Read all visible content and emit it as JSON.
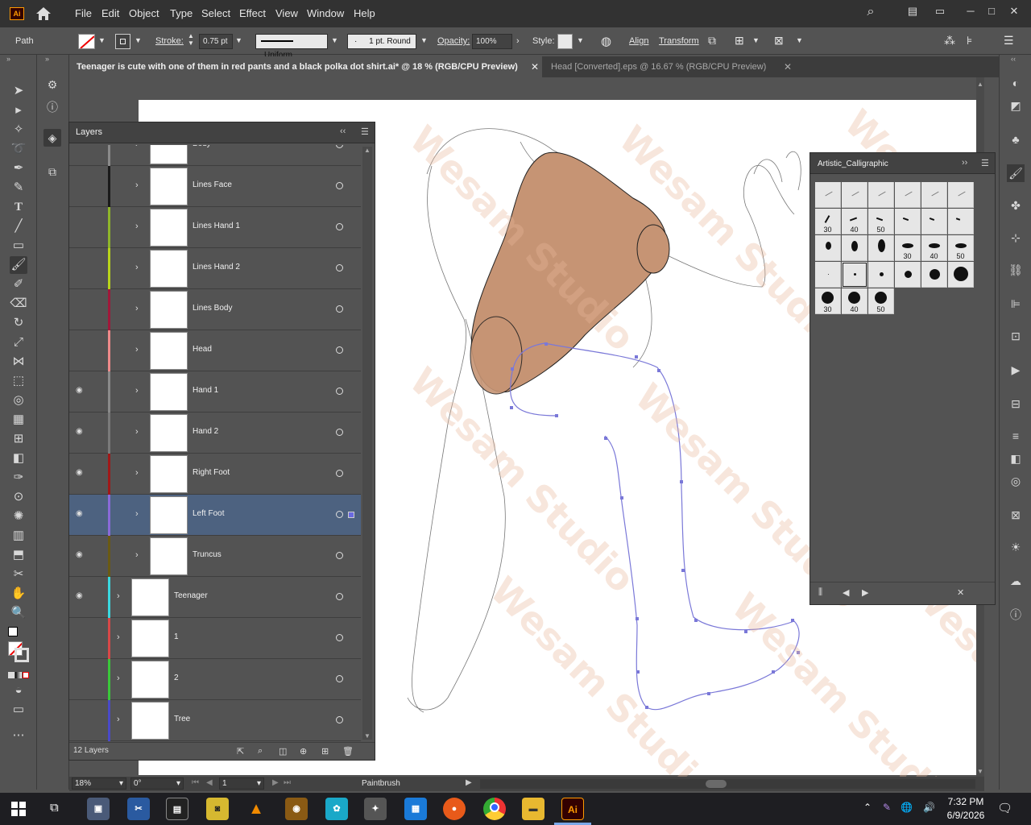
{
  "app": {
    "logo": "Ai"
  },
  "menu": [
    "File",
    "Edit",
    "Object",
    "Type",
    "Select",
    "Effect",
    "View",
    "Window",
    "Help"
  ],
  "control": {
    "selection_type": "Path",
    "stroke_label": "Stroke:",
    "stroke_weight": "0.75 pt",
    "profile": "Uniform",
    "brush": "1 pt. Round",
    "opacity_label": "Opacity:",
    "opacity": "100%",
    "style_label": "Style:",
    "align": "Align",
    "transform": "Transform"
  },
  "tabs": [
    {
      "label": "Teenager is cute with one of them in red pants and a black polka dot shirt.ai* @ 18 % (RGB/CPU Preview)",
      "active": true
    },
    {
      "label": "Head [Converted].eps @ 16.67 % (RGB/CPU Preview)",
      "active": false
    }
  ],
  "layers_panel": {
    "title": "Layers",
    "count": "12 Layers",
    "rows": [
      {
        "name": "Body",
        "visible": false,
        "color": "#8a8a8a",
        "sub": true
      },
      {
        "name": "Lines Face",
        "visible": false,
        "color": "#1a1a1a",
        "sub": true
      },
      {
        "name": "Lines Hand 1",
        "visible": false,
        "color": "#8fb52a",
        "sub": true
      },
      {
        "name": "Lines Hand 2",
        "visible": false,
        "color": "#b8d41a",
        "sub": true
      },
      {
        "name": "Lines Body",
        "visible": false,
        "color": "#a0183a",
        "sub": true
      },
      {
        "name": "Head",
        "visible": false,
        "color": "#ee8a8a",
        "sub": true
      },
      {
        "name": "Hand 1",
        "visible": true,
        "color": "#8a8a8a",
        "sub": true
      },
      {
        "name": "Hand 2",
        "visible": true,
        "color": "#7a7a7a",
        "sub": true
      },
      {
        "name": "Right Foot",
        "visible": true,
        "color": "#a01818",
        "sub": true
      },
      {
        "name": "Left Foot",
        "visible": true,
        "color": "#8a6ad8",
        "sub": true,
        "selected": true
      },
      {
        "name": "Truncus",
        "visible": true,
        "color": "#6a5a14",
        "sub": true
      },
      {
        "name": "Teenager",
        "visible": true,
        "color": "#3ad8e0",
        "sub": false
      },
      {
        "name": "1",
        "visible": false,
        "color": "#d84848",
        "sub": false
      },
      {
        "name": "2",
        "visible": false,
        "color": "#3ac83a",
        "sub": false
      },
      {
        "name": "Tree",
        "visible": false,
        "color": "#4a4ac8",
        "sub": false
      }
    ]
  },
  "brush_panel": {
    "title": "Artistic_Calligraphic",
    "rows": [
      [
        "",
        "",
        "",
        "",
        "",
        ""
      ],
      [
        "30",
        "40",
        "50",
        "",
        "",
        ""
      ],
      [
        "",
        "",
        "",
        "30",
        "40",
        "50"
      ],
      [
        "",
        "",
        "",
        "",
        "",
        ""
      ],
      [
        "30",
        "40",
        "50"
      ]
    ]
  },
  "status": {
    "zoom": "18%",
    "rotation": "0°",
    "artboard": "1",
    "tool": "Paintbrush"
  },
  "taskbar": {
    "time": "7:32 PM",
    "date": "6/9/2026"
  },
  "watermark": "Wesam Studio",
  "colors": {
    "accent": "#ff9a00",
    "skin": "#c69474",
    "path": "#7a78d8",
    "selection": "#4d6280"
  }
}
